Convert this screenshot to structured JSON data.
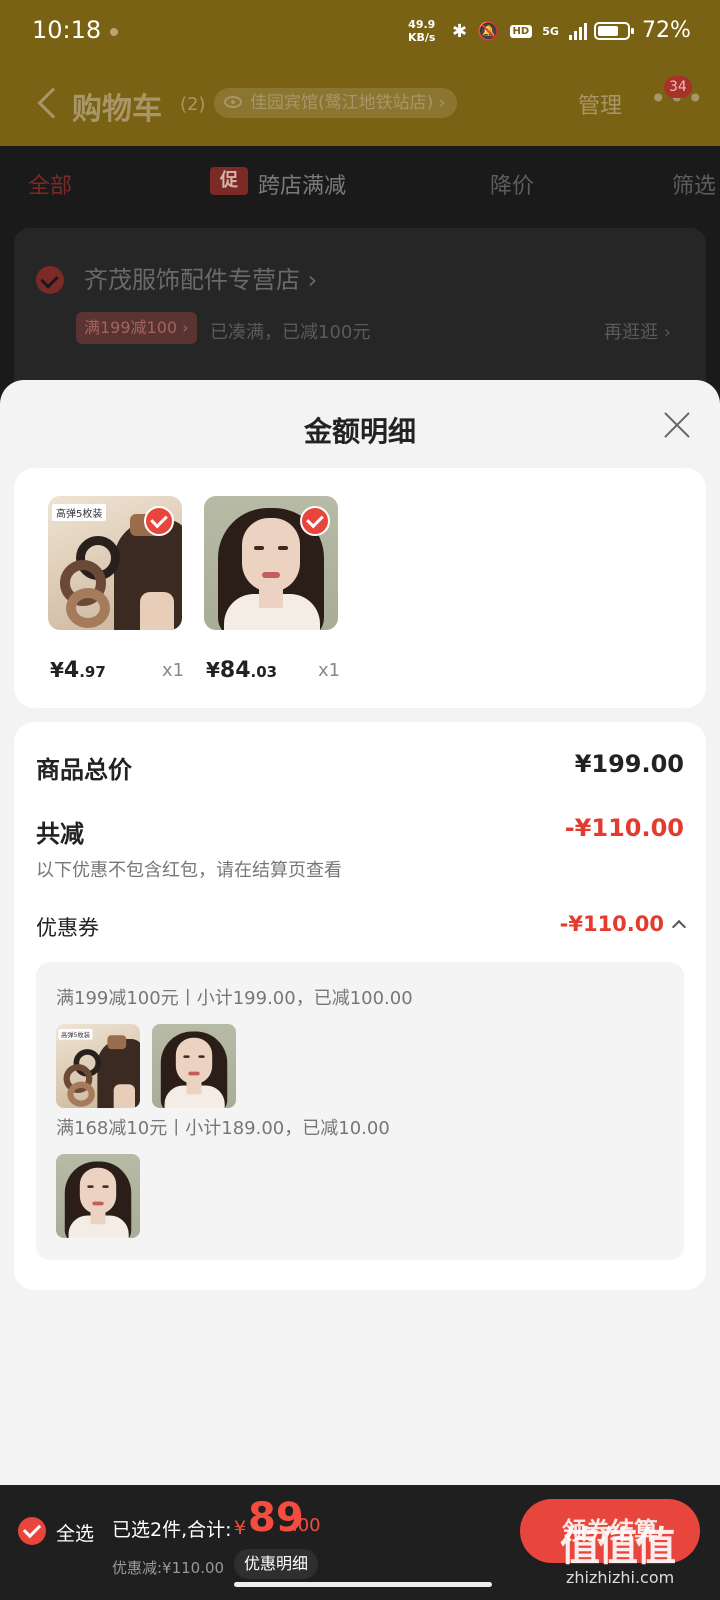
{
  "status_bar": {
    "time": "10:18",
    "speed_value": "49.9",
    "speed_unit": "KB/s",
    "hd": "HD",
    "network": "5G",
    "battery_pct_text": "72%",
    "battery_level": 0.72
  },
  "nav": {
    "title": "购物车",
    "count": "(2)",
    "location": "佳园宾馆(鹭江地铁站店)",
    "manage": "管理",
    "badge": "34"
  },
  "filters": {
    "all": "全部",
    "promo_tag": "促",
    "cross_store": "跨店满减",
    "price_drop": "降价",
    "filter": "筛选"
  },
  "store": {
    "name": "齐茂服饰配件专营店",
    "promo_tag": "满199减100",
    "promo_tip": "已凑满，已减100元",
    "browse_more": "再逛逛"
  },
  "sheet": {
    "title": "金额明细",
    "goods": [
      {
        "price_currency": "¥",
        "price_int": "4",
        "price_dec": ".97",
        "qty": "x1",
        "tag_text": "高弹5枚装"
      },
      {
        "price_currency": "¥",
        "price_int": "84",
        "price_dec": ".03",
        "qty": "x1"
      }
    ],
    "summary": {
      "total_label": "商品总价",
      "total_value": "¥199.00",
      "discount_label": "共减",
      "discount_value": "-¥110.00",
      "note": "以下优惠不包含红包，请在结算页查看",
      "coupon_label": "优惠券",
      "coupon_value": "-¥110.00",
      "coupon_lines": [
        "满199减100元丨小计199.00，已减100.00",
        "满168减10元丨小计189.00，已减10.00"
      ]
    }
  },
  "bottom": {
    "select_all": "全选",
    "selected_text": "已选2件,合计:",
    "total_currency": "¥",
    "total_int": "89",
    "total_dec": ".00",
    "discount_text": "优惠减:¥110.00",
    "detail_button": "优惠明细",
    "checkout_button": "领券结算"
  },
  "watermark": {
    "logo": "值值值",
    "url": "zhizhizhi.com"
  },
  "colors": {
    "accent": "#e8453c",
    "discount_red": "#e33b2e",
    "header_bg": "#7a6215"
  }
}
